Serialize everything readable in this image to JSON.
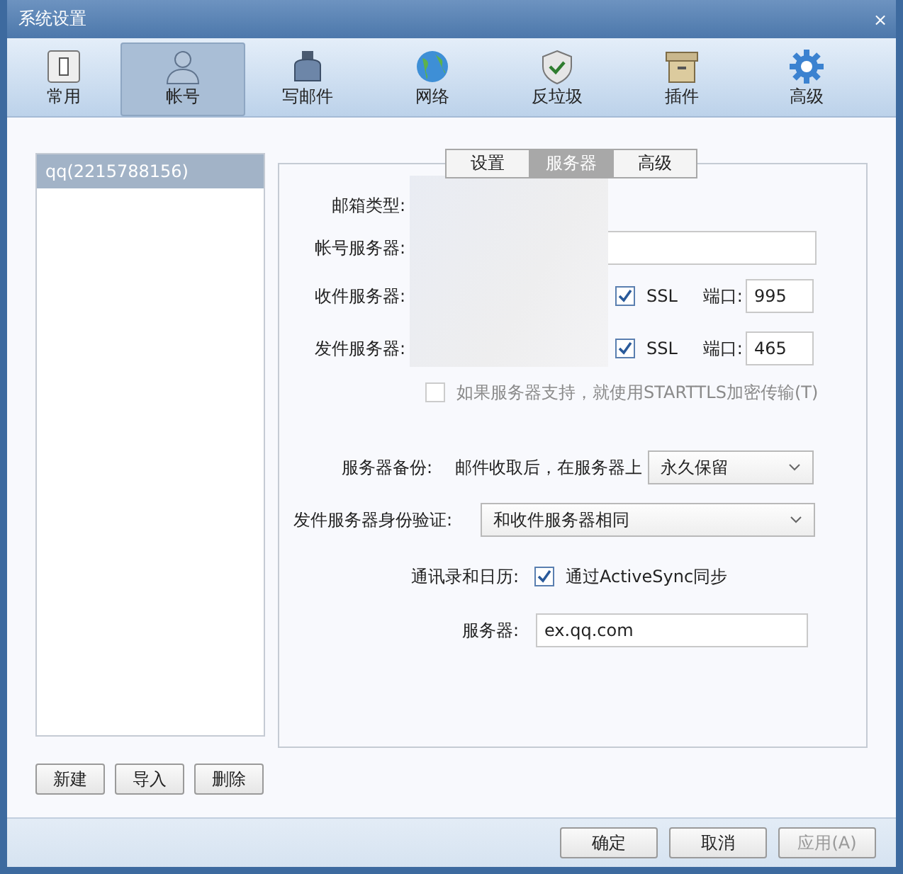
{
  "window": {
    "title": "系统设置",
    "close": "×"
  },
  "toolbar": [
    {
      "label": "常用",
      "kind": "switch",
      "selected": false
    },
    {
      "label": "帐号",
      "kind": "person",
      "selected": true
    },
    {
      "label": "写邮件",
      "kind": "ink",
      "selected": false
    },
    {
      "label": "网络",
      "kind": "globe",
      "selected": false
    },
    {
      "label": "反垃圾",
      "kind": "shield",
      "selected": false
    },
    {
      "label": "插件",
      "kind": "box",
      "selected": false
    },
    {
      "label": "高级",
      "kind": "gear",
      "selected": false
    }
  ],
  "accounts": [
    {
      "label": "qq(2215788156)",
      "selected": true
    }
  ],
  "account_buttons": [
    "新建",
    "导入",
    "删除"
  ],
  "subtabs": [
    {
      "label": "设置",
      "selected": false
    },
    {
      "label": "服务器",
      "selected": true
    },
    {
      "label": "高级",
      "selected": false
    }
  ],
  "form": {
    "mailbox_type_label": "邮箱类型:",
    "account_server_label": "帐号服务器:",
    "incoming_label": "收件服务器:",
    "outgoing_label": "发件服务器:",
    "incoming_ssl": {
      "label": "SSL",
      "checked": true
    },
    "incoming_port_label": "端口:",
    "incoming_port": "995",
    "outgoing_ssl": {
      "label": "SSL",
      "checked": true
    },
    "outgoing_port_label": "端口:",
    "outgoing_port": "465",
    "starttls": {
      "label": "如果服务器支持，就使用STARTTLS加密传输(T)",
      "checked": false,
      "disabled": true
    },
    "backup_label": "服务器备份:",
    "backup_text": "邮件收取后，在服务器上",
    "backup_value": "永久保留",
    "auth_label": "发件服务器身份验证:",
    "auth_value": "和收件服务器相同",
    "contacts_label": "通讯录和日历:",
    "activesync": {
      "label": "通过ActiveSync同步",
      "checked": true
    },
    "server_label": "服务器:",
    "server_value": "ex.qq.com"
  },
  "footer_buttons": [
    {
      "label": "确定",
      "disabled": false
    },
    {
      "label": "取消",
      "disabled": false
    },
    {
      "label": "应用(A)",
      "disabled": true
    }
  ]
}
